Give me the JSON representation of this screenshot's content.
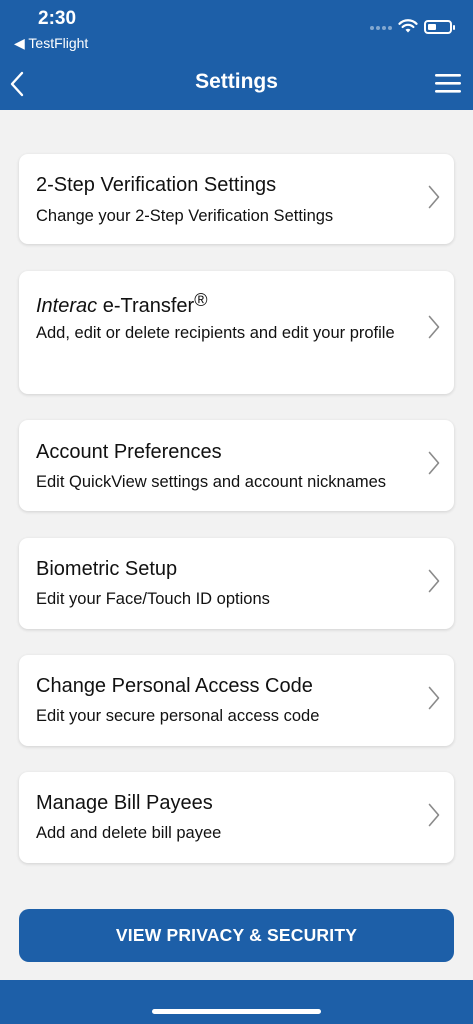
{
  "status": {
    "time": "2:30",
    "back_app": "◀ TestFlight"
  },
  "nav": {
    "title": "Settings",
    "back_icon": "chevron-left-icon",
    "menu_icon": "hamburger-menu-icon"
  },
  "settings": [
    {
      "title": "2-Step Verification Settings",
      "subtitle": "Change your 2-Step Verification Settings"
    },
    {
      "title_italic": "Interac",
      "title_rest": " e-Transfer",
      "title_mark": "®",
      "subtitle": "Add, edit or delete recipients and edit your profile"
    },
    {
      "title": "Account Preferences",
      "subtitle": "Edit QuickView settings and account nicknames"
    },
    {
      "title": "Biometric Setup",
      "subtitle": "Edit your Face/Touch ID options"
    },
    {
      "title": "Change Personal Access Code",
      "subtitle": "Edit your secure personal access code"
    },
    {
      "title": "Manage Bill Payees",
      "subtitle": "Add and delete bill payee"
    }
  ],
  "cta": {
    "label": "VIEW PRIVACY & SECURITY"
  },
  "colors": {
    "primary": "#1d5fa8",
    "background": "#f2f2f2",
    "card": "#ffffff"
  }
}
